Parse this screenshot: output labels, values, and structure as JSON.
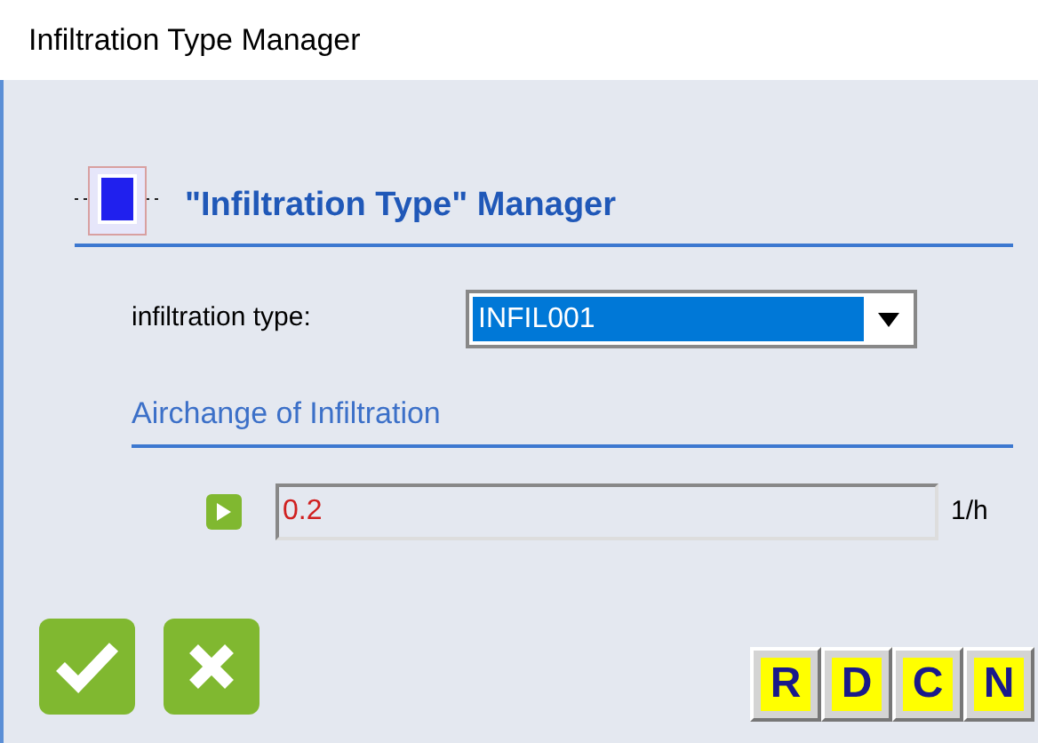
{
  "window": {
    "title": "Infiltration Type Manager"
  },
  "header": {
    "title": "\"Infiltration Type\" Manager"
  },
  "type_field": {
    "label": "infiltration type:",
    "value": "INFIL001"
  },
  "section": {
    "title": "Airchange of Infiltration"
  },
  "airchange": {
    "value": "0.2",
    "unit": "1/h"
  },
  "letter_buttons": [
    "R",
    "D",
    "C",
    "N"
  ]
}
